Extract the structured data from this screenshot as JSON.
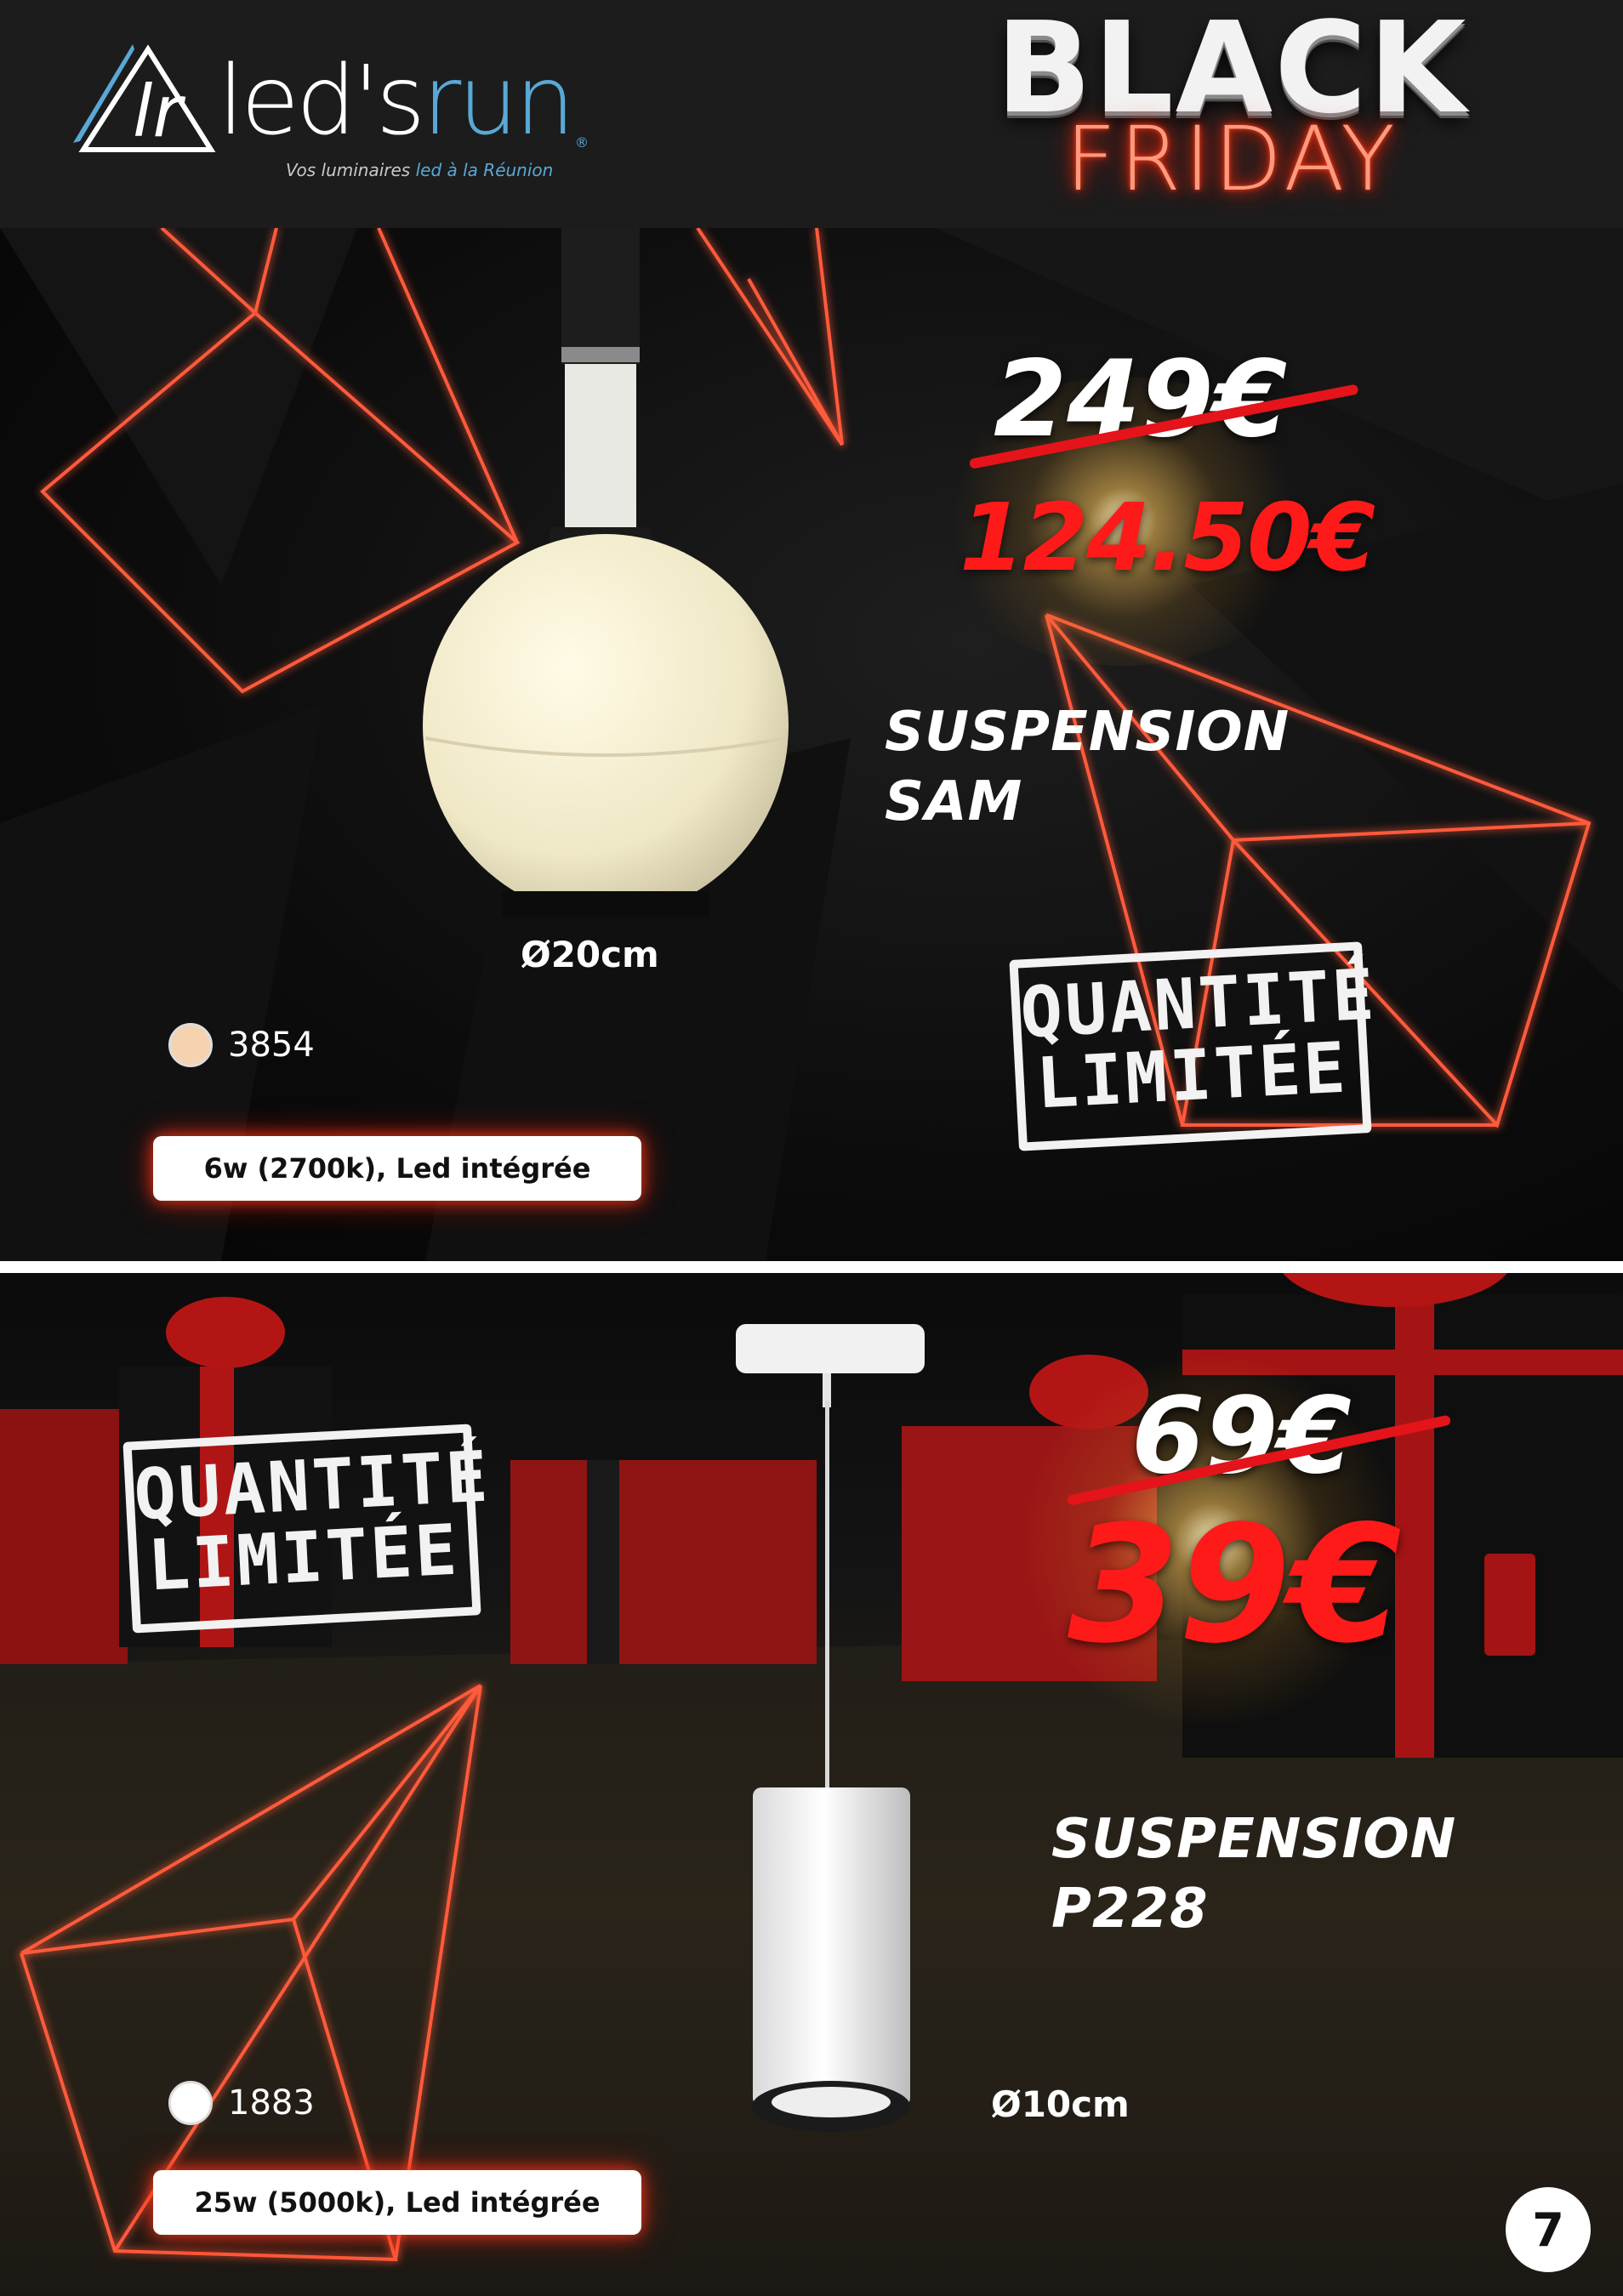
{
  "brand": {
    "logo_prefix": "led's",
    "logo_suffix": "run",
    "registered": "®",
    "tagline_start": "Vos luminaires ",
    "tagline_highlight": "led à la Réunion"
  },
  "banner": {
    "line1": "BLACK",
    "line2": "FRIDAY"
  },
  "colors": {
    "accent_red": "#e4141a",
    "neon_red": "#ff3a1a",
    "brand_blue": "#59a8d6",
    "header_bg": "#1c1c1c"
  },
  "products": [
    {
      "name_line1": "SUSPENSION",
      "name_line2": "SAM",
      "old_price": "249€",
      "new_price": "124.50€",
      "diameter": "Ø20cm",
      "reference": "3854",
      "swatch_color": "#f6d3b0",
      "spec": "6w (2700k), Led intégrée",
      "stamp_line1": "QUANTITÉ",
      "stamp_line2": "LIMITÉE"
    },
    {
      "name_line1": "SUSPENSION",
      "name_line2": "P228",
      "old_price": "69€",
      "new_price": "39€",
      "diameter": "Ø10cm",
      "reference": "1883",
      "swatch_color": "#ffffff",
      "spec": "25w (5000k), Led intégrée",
      "stamp_line1": "QUANTITÉ",
      "stamp_line2": "LIMITÉE"
    }
  ],
  "page_number": "7"
}
